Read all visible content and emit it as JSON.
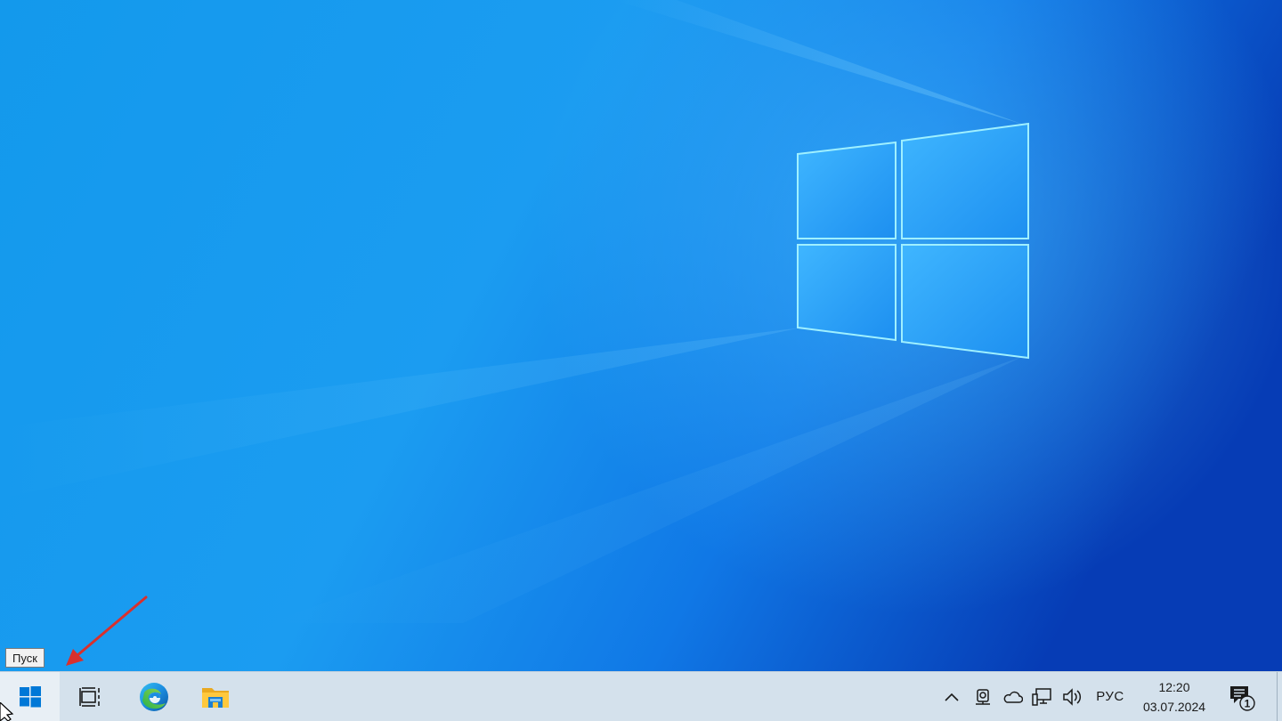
{
  "tooltip": {
    "text": "Пуск"
  },
  "taskbar": {
    "pinned": [
      {
        "name": "start",
        "icon": "windows-logo-icon"
      },
      {
        "name": "task-view",
        "icon": "task-view-icon"
      },
      {
        "name": "edge",
        "icon": "edge-icon"
      },
      {
        "name": "file-explorer",
        "icon": "folder-icon"
      }
    ],
    "tray": {
      "language": "РУС",
      "icons": [
        "chevron-up-icon",
        "meet-now-icon",
        "onedrive-cloud-icon",
        "network-icon",
        "volume-icon"
      ]
    },
    "clock": {
      "time": "12:20",
      "date": "03.07.2024"
    },
    "notifications": {
      "count": "1",
      "icon": "action-center-icon"
    }
  },
  "colors": {
    "wallpaper_light": "#1a9af0",
    "wallpaper_dark": "#0a3fb8",
    "taskbar": "#d4e1ec",
    "accent": "#0078d7",
    "annotation_arrow": "#d9302c"
  }
}
